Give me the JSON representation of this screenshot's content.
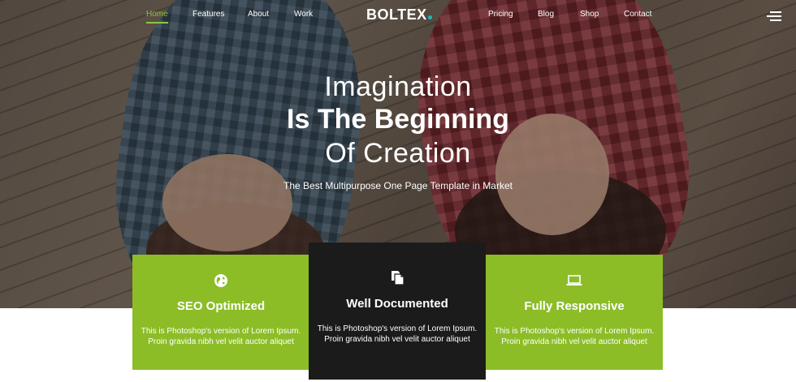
{
  "nav": {
    "left_links": [
      "Home",
      "Features",
      "About",
      "Work"
    ],
    "right_links": [
      "Pricing",
      "Blog",
      "Shop",
      "Contact"
    ],
    "active": "Home",
    "brand": "BOLTEX",
    "menu_icon": "hamburger-icon"
  },
  "hero": {
    "line1": "Imagination",
    "line2": "Is The Beginning",
    "line3": "Of Creation",
    "tagline": "The Best Multipurpose One Page Template in Market"
  },
  "features": [
    {
      "icon": "globe-icon",
      "title": "SEO Optimized",
      "text": "This is Photoshop's version of Lorem Ipsum. Proin gravida nibh vel velit auctor aliquet"
    },
    {
      "icon": "documents-icon",
      "title": "Well Documented",
      "text": "This is Photoshop's version of Lorem Ipsum. Proin gravida nibh vel velit auctor aliquet"
    },
    {
      "icon": "laptop-icon",
      "title": "Fully Responsive",
      "text": "This is Photoshop's version of Lorem Ipsum. Proin gravida nibh vel velit auctor aliquet"
    }
  ],
  "colors": {
    "accent_green": "#8cbd27",
    "dark_card": "#1b1b1b",
    "brand_dot": "#1fb6c1",
    "active_nav": "#8cc63f"
  }
}
